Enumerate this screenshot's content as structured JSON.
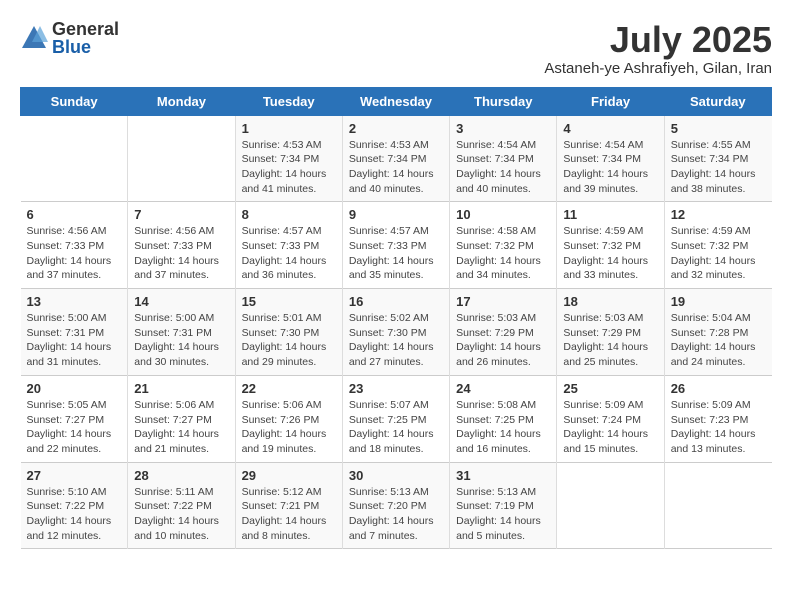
{
  "logo": {
    "general": "General",
    "blue": "Blue"
  },
  "title": {
    "month": "July 2025",
    "location": "Astaneh-ye Ashrafiyeh, Gilan, Iran"
  },
  "weekdays": [
    "Sunday",
    "Monday",
    "Tuesday",
    "Wednesday",
    "Thursday",
    "Friday",
    "Saturday"
  ],
  "weeks": [
    [
      {
        "day": "",
        "info": ""
      },
      {
        "day": "",
        "info": ""
      },
      {
        "day": "1",
        "info": "Sunrise: 4:53 AM\nSunset: 7:34 PM\nDaylight: 14 hours and 41 minutes."
      },
      {
        "day": "2",
        "info": "Sunrise: 4:53 AM\nSunset: 7:34 PM\nDaylight: 14 hours and 40 minutes."
      },
      {
        "day": "3",
        "info": "Sunrise: 4:54 AM\nSunset: 7:34 PM\nDaylight: 14 hours and 40 minutes."
      },
      {
        "day": "4",
        "info": "Sunrise: 4:54 AM\nSunset: 7:34 PM\nDaylight: 14 hours and 39 minutes."
      },
      {
        "day": "5",
        "info": "Sunrise: 4:55 AM\nSunset: 7:34 PM\nDaylight: 14 hours and 38 minutes."
      }
    ],
    [
      {
        "day": "6",
        "info": "Sunrise: 4:56 AM\nSunset: 7:33 PM\nDaylight: 14 hours and 37 minutes."
      },
      {
        "day": "7",
        "info": "Sunrise: 4:56 AM\nSunset: 7:33 PM\nDaylight: 14 hours and 37 minutes."
      },
      {
        "day": "8",
        "info": "Sunrise: 4:57 AM\nSunset: 7:33 PM\nDaylight: 14 hours and 36 minutes."
      },
      {
        "day": "9",
        "info": "Sunrise: 4:57 AM\nSunset: 7:33 PM\nDaylight: 14 hours and 35 minutes."
      },
      {
        "day": "10",
        "info": "Sunrise: 4:58 AM\nSunset: 7:32 PM\nDaylight: 14 hours and 34 minutes."
      },
      {
        "day": "11",
        "info": "Sunrise: 4:59 AM\nSunset: 7:32 PM\nDaylight: 14 hours and 33 minutes."
      },
      {
        "day": "12",
        "info": "Sunrise: 4:59 AM\nSunset: 7:32 PM\nDaylight: 14 hours and 32 minutes."
      }
    ],
    [
      {
        "day": "13",
        "info": "Sunrise: 5:00 AM\nSunset: 7:31 PM\nDaylight: 14 hours and 31 minutes."
      },
      {
        "day": "14",
        "info": "Sunrise: 5:00 AM\nSunset: 7:31 PM\nDaylight: 14 hours and 30 minutes."
      },
      {
        "day": "15",
        "info": "Sunrise: 5:01 AM\nSunset: 7:30 PM\nDaylight: 14 hours and 29 minutes."
      },
      {
        "day": "16",
        "info": "Sunrise: 5:02 AM\nSunset: 7:30 PM\nDaylight: 14 hours and 27 minutes."
      },
      {
        "day": "17",
        "info": "Sunrise: 5:03 AM\nSunset: 7:29 PM\nDaylight: 14 hours and 26 minutes."
      },
      {
        "day": "18",
        "info": "Sunrise: 5:03 AM\nSunset: 7:29 PM\nDaylight: 14 hours and 25 minutes."
      },
      {
        "day": "19",
        "info": "Sunrise: 5:04 AM\nSunset: 7:28 PM\nDaylight: 14 hours and 24 minutes."
      }
    ],
    [
      {
        "day": "20",
        "info": "Sunrise: 5:05 AM\nSunset: 7:27 PM\nDaylight: 14 hours and 22 minutes."
      },
      {
        "day": "21",
        "info": "Sunrise: 5:06 AM\nSunset: 7:27 PM\nDaylight: 14 hours and 21 minutes."
      },
      {
        "day": "22",
        "info": "Sunrise: 5:06 AM\nSunset: 7:26 PM\nDaylight: 14 hours and 19 minutes."
      },
      {
        "day": "23",
        "info": "Sunrise: 5:07 AM\nSunset: 7:25 PM\nDaylight: 14 hours and 18 minutes."
      },
      {
        "day": "24",
        "info": "Sunrise: 5:08 AM\nSunset: 7:25 PM\nDaylight: 14 hours and 16 minutes."
      },
      {
        "day": "25",
        "info": "Sunrise: 5:09 AM\nSunset: 7:24 PM\nDaylight: 14 hours and 15 minutes."
      },
      {
        "day": "26",
        "info": "Sunrise: 5:09 AM\nSunset: 7:23 PM\nDaylight: 14 hours and 13 minutes."
      }
    ],
    [
      {
        "day": "27",
        "info": "Sunrise: 5:10 AM\nSunset: 7:22 PM\nDaylight: 14 hours and 12 minutes."
      },
      {
        "day": "28",
        "info": "Sunrise: 5:11 AM\nSunset: 7:22 PM\nDaylight: 14 hours and 10 minutes."
      },
      {
        "day": "29",
        "info": "Sunrise: 5:12 AM\nSunset: 7:21 PM\nDaylight: 14 hours and 8 minutes."
      },
      {
        "day": "30",
        "info": "Sunrise: 5:13 AM\nSunset: 7:20 PM\nDaylight: 14 hours and 7 minutes."
      },
      {
        "day": "31",
        "info": "Sunrise: 5:13 AM\nSunset: 7:19 PM\nDaylight: 14 hours and 5 minutes."
      },
      {
        "day": "",
        "info": ""
      },
      {
        "day": "",
        "info": ""
      }
    ]
  ]
}
